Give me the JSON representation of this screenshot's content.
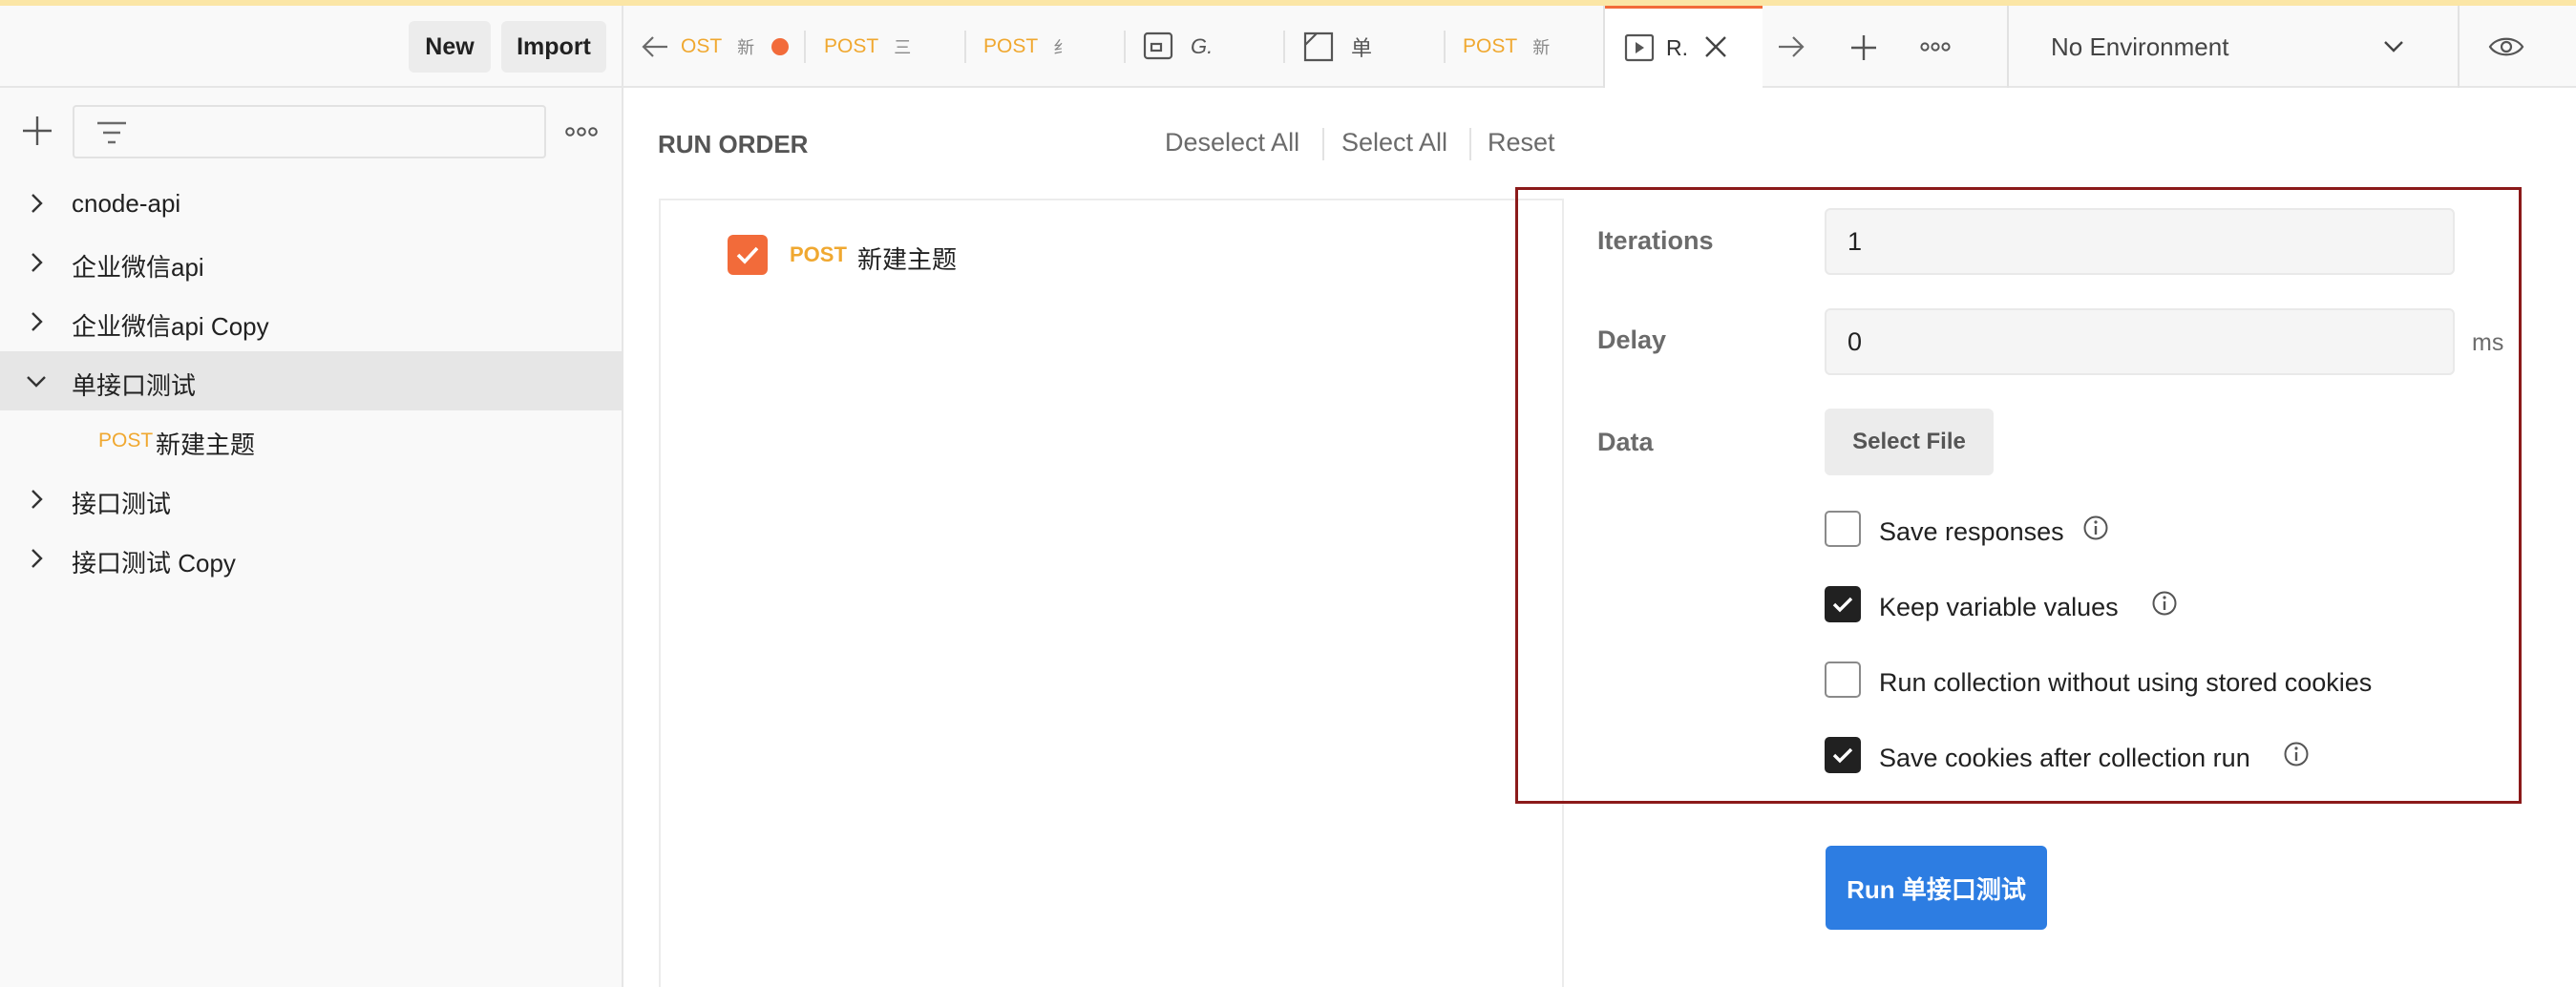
{
  "sidebar": {
    "new_label": "New",
    "import_label": "Import",
    "filter_placeholder": "",
    "items": [
      {
        "label": "cnode-api",
        "expanded": false
      },
      {
        "label": "企业微信api",
        "expanded": false
      },
      {
        "label": "企业微信api Copy",
        "expanded": false
      },
      {
        "label": "单接口测试",
        "expanded": true
      },
      {
        "label": "接口测试",
        "expanded": false
      },
      {
        "label": "接口测试 Copy",
        "expanded": false
      }
    ],
    "child": {
      "method": "POST",
      "label": "新建主题"
    }
  },
  "tabs": [
    {
      "method": "OST",
      "label": "新",
      "unsaved": true
    },
    {
      "method": "POST",
      "label": "三"
    },
    {
      "method": "POST",
      "label": "纟"
    },
    {
      "label": "G."
    },
    {
      "label": "单"
    },
    {
      "method": "POST",
      "label": "新"
    },
    {
      "label": "R.",
      "active": true
    }
  ],
  "environment": {
    "selected": "No Environment"
  },
  "run_order": {
    "title": "RUN ORDER",
    "deselect_all": "Deselect All",
    "select_all": "Select All",
    "reset": "Reset",
    "requests": [
      {
        "checked": true,
        "method": "POST",
        "name": "新建主题"
      }
    ]
  },
  "settings": {
    "iterations_label": "Iterations",
    "iterations_value": "1",
    "delay_label": "Delay",
    "delay_value": "0",
    "delay_unit": "ms",
    "data_label": "Data",
    "select_file": "Select File",
    "options": [
      {
        "label": "Save responses",
        "checked": false,
        "info": true
      },
      {
        "label": "Keep variable values",
        "checked": true,
        "info": true
      },
      {
        "label": "Run collection without using stored cookies",
        "checked": false,
        "info": false
      },
      {
        "label": "Save cookies after collection run",
        "checked": true,
        "info": true
      }
    ]
  },
  "run_button": "Run 单接口测试",
  "colors": {
    "accent_orange": "#f26b3a",
    "post_method": "#f0a830",
    "run_button": "#2d7de2",
    "highlight_border": "#8b1a1a"
  }
}
